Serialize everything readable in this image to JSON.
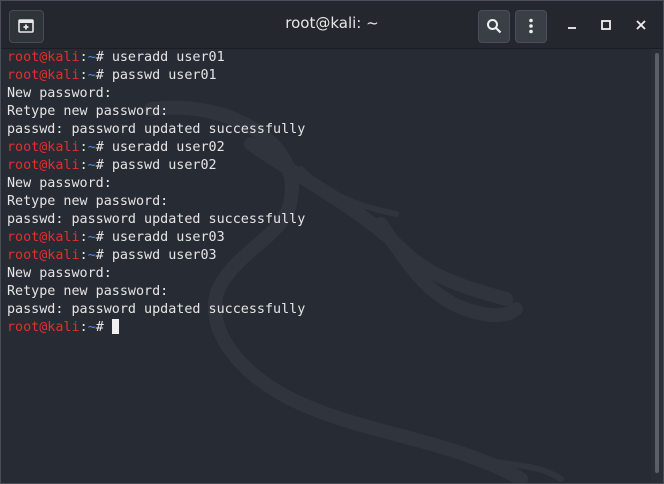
{
  "window": {
    "title": "root@kali: ~"
  },
  "prompt": {
    "user_host": "root@kali",
    "separator": ":",
    "path": "~",
    "symbol": "#"
  },
  "lines": [
    {
      "type": "prompt",
      "cmd": "useradd user01"
    },
    {
      "type": "prompt",
      "cmd": "passwd user01"
    },
    {
      "type": "output",
      "text": "New password:"
    },
    {
      "type": "output",
      "text": "Retype new password:"
    },
    {
      "type": "output",
      "text": "passwd: password updated successfully"
    },
    {
      "type": "prompt",
      "cmd": "useradd user02"
    },
    {
      "type": "prompt",
      "cmd": "passwd user02"
    },
    {
      "type": "output",
      "text": "New password:"
    },
    {
      "type": "output",
      "text": "Retype new password:"
    },
    {
      "type": "output",
      "text": "passwd: password updated successfully"
    },
    {
      "type": "prompt",
      "cmd": "useradd user03"
    },
    {
      "type": "prompt",
      "cmd": "passwd user03"
    },
    {
      "type": "output",
      "text": "New password:"
    },
    {
      "type": "output",
      "text": "Retype new password:"
    },
    {
      "type": "output",
      "text": "passwd: password updated successfully"
    },
    {
      "type": "prompt",
      "cmd": "",
      "cursor": true
    }
  ],
  "icons": {
    "new_tab": "new-tab-icon",
    "search": "search-icon",
    "menu": "kebab-menu-icon",
    "minimize": "minimize-icon",
    "maximize": "maximize-icon",
    "close": "close-icon",
    "background": "kali-dragon-icon"
  },
  "colors": {
    "prompt_user": "#e0302f",
    "prompt_path": "#4b8df0",
    "text": "#e5e5e5",
    "background": "#272b33"
  }
}
